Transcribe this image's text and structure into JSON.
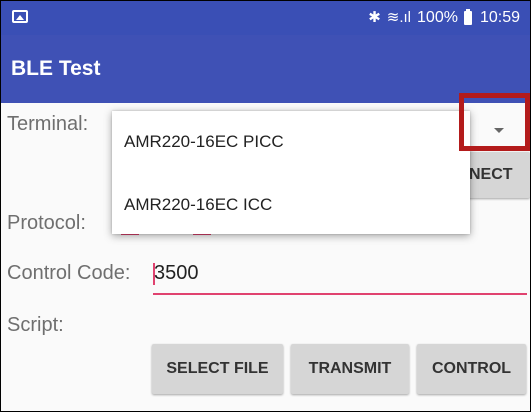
{
  "status_bar": {
    "icons": [
      "image-icon",
      "bluetooth-icon",
      "wifi-icon",
      "signal-icon",
      "battery-icon"
    ],
    "bluetooth_glyph": "✱",
    "wifi_signal_glyph": "≋.ıl",
    "battery_level": "100%",
    "time": "10:59"
  },
  "app_bar": {
    "title": "BLE Test"
  },
  "form": {
    "terminal_label": "Terminal:",
    "connect_label_fragment": "NECT",
    "protocol_label": "Protocol:",
    "control_code_label": "Control Code:",
    "control_code_value": "3500",
    "script_label": "Script:"
  },
  "dropdown": {
    "options": [
      "AMR220-16EC PICC",
      "AMR220-16EC ICC"
    ]
  },
  "buttons": {
    "select_file": "SELECT FILE",
    "transmit": "TRANSMIT",
    "control": "CONTROL"
  },
  "colors": {
    "status_bar": "#3a4fb5",
    "app_bar": "#3f51b5",
    "accent": "#e0426f",
    "highlight_box": "#b31b1b"
  }
}
